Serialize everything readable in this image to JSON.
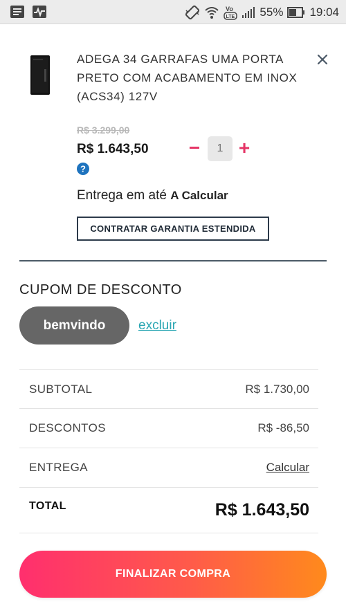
{
  "status_bar": {
    "battery": "55%",
    "time": "19:04",
    "volte": "Vo LTE",
    "icons": [
      "notification-icon",
      "activity-icon",
      "vibrate-icon",
      "wifi-icon",
      "volte-icon",
      "signal-icon",
      "battery-icon"
    ]
  },
  "cart_item": {
    "title": "ADEGA 34 GARRAFAS UMA PORTA PRETO COM ACABAMENTO EM INOX (ACS34) 127V",
    "old_price": "R$ 3.299,00",
    "price": "R$ 1.643,50",
    "quantity": "1",
    "minus_label": "−",
    "plus_label": "+",
    "delivery_prefix": "Entrega em até",
    "delivery_value": "A Calcular",
    "warranty_button": "CONTRATAR GARANTIA ESTENDIDA"
  },
  "coupon": {
    "heading": "CUPOM DE DESCONTO",
    "code": "bemvindo",
    "remove_label": "excluir"
  },
  "summary": {
    "subtotal_label": "SUBTOTAL",
    "subtotal_value": "R$ 1.730,00",
    "discounts_label": "DESCONTOS",
    "discounts_value": "R$ -86,50",
    "shipping_label": "ENTREGA",
    "shipping_value": "Calcular",
    "total_label": "TOTAL",
    "total_value": "R$ 1.643,50"
  },
  "checkout_button": "FINALIZAR COMPRA",
  "colors": {
    "accent_pink": "#e53466",
    "link_teal": "#2aa6b3",
    "chip_gray": "#666666",
    "button_gradient_start": "#ff2f6e",
    "button_gradient_end": "#ff8a1c"
  }
}
